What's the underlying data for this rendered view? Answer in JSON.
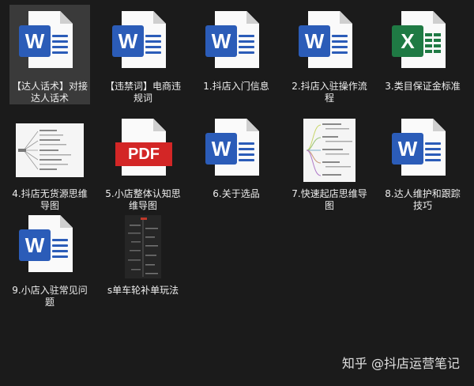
{
  "files": [
    {
      "label": "【达人话术】对接达人话术",
      "type": "word"
    },
    {
      "label": "【违禁词】电商违规词",
      "type": "word"
    },
    {
      "label": "1.抖店入门信息",
      "type": "word"
    },
    {
      "label": "2.抖店入驻操作流程",
      "type": "word"
    },
    {
      "label": "3.类目保证金标准",
      "type": "excel"
    },
    {
      "label": "4.抖店无货源思维导图",
      "type": "mindmap"
    },
    {
      "label": "5.小店整体认知思维导图",
      "type": "pdf"
    },
    {
      "label": "6.关于选品",
      "type": "word"
    },
    {
      "label": "7.快速起店思维导图",
      "type": "mindmap"
    },
    {
      "label": "8.达人维护和跟踪技巧",
      "type": "word"
    },
    {
      "label": "9.小店入驻常见问题",
      "type": "word"
    },
    {
      "label": "s单车轮补单玩法",
      "type": "mindmap"
    }
  ],
  "icons": {
    "word_letter": "W",
    "excel_letter": "X",
    "pdf_text": "PDF"
  },
  "colors": {
    "background": "#1b1b1b",
    "selected": "#3a3a3a",
    "word_blue": "#2b5cb8",
    "excel_green": "#1f7a44",
    "pdf_red": "#d32626"
  },
  "watermark": "知乎 @抖店运营笔记"
}
